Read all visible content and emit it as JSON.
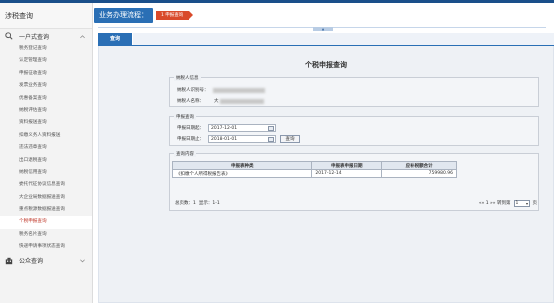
{
  "sidebar": {
    "title": "涉税查询",
    "group1": "一户式查询",
    "items": [
      "税务登记查询",
      "认定管理查询",
      "申报征收查询",
      "发票业务查询",
      "优惠备案查询",
      "纳税评估查询",
      "资料报送查询",
      "扣缴义务人资料报送",
      "违法违章查询",
      "出口退税查询",
      "纳税信用查询",
      "委托代征协议信息查询",
      "大企业局数据报送查询",
      "重点税源数据报送查询",
      "个税申报查询",
      "税务名片查询",
      "快递申请事项状态查询"
    ],
    "active_index": 14,
    "group2": "公众查询"
  },
  "flow": {
    "title": "业务办理流程：",
    "step": "1 申报查询"
  },
  "tab": "查询",
  "page_title": "个税申报查询",
  "taxpayer": {
    "legend": "纳税人信息",
    "id_label": "纳税人识别号：",
    "name_label": "纳税人名称：",
    "name_prefix": "大"
  },
  "query": {
    "legend": "申报查询",
    "start_label": "申报日期起：",
    "start_value": "2017-12-01",
    "end_label": "申报日期止：",
    "end_value": "2018-01-01",
    "button": "查询"
  },
  "results": {
    "legend": "查询内容",
    "headers": [
      "申报表种类",
      "申报表申报日期",
      "应补税额合计"
    ],
    "rows": [
      [
        "《扣缴个人所得税报告表》",
        "2017-12-14",
        "759980.96"
      ]
    ]
  },
  "pager": {
    "total": "总页数：1",
    "showing": "显示：1-1",
    "nav": "«« 1 »» 转到第",
    "page_select": "1",
    "page_suffix": "页"
  }
}
